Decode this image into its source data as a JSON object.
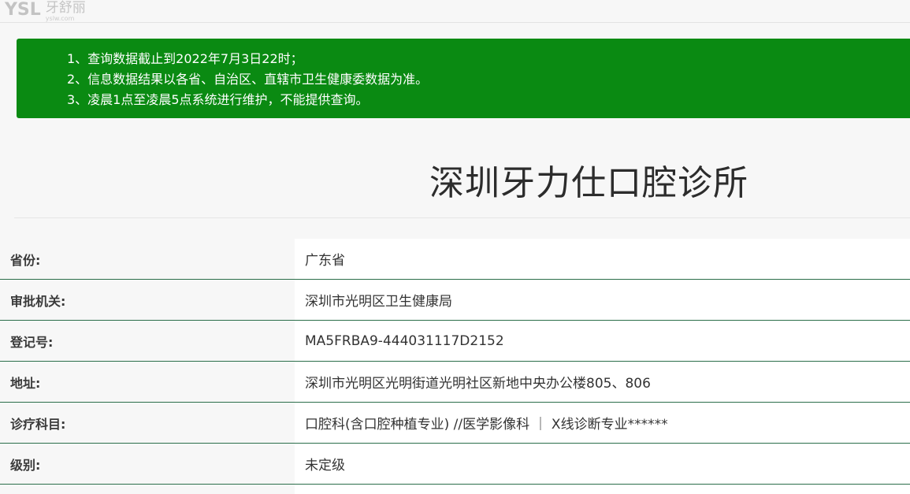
{
  "header": {
    "logo_mark": "YSL",
    "logo_cn": "牙舒丽",
    "logo_url": "yslw.com"
  },
  "notice": {
    "lines": [
      "1、查询数据截止到2022年7月3日22时；",
      "2、信息数据结果以各省、自治区、直辖市卫生健康委数据为准。",
      "3、凌晨1点至凌晨5点系统进行维护，不能提供查询。"
    ],
    "color": "#0a8a12"
  },
  "clinic": {
    "name": "深圳牙力仕口腔诊所"
  },
  "info": [
    {
      "label": "省份:",
      "value": "广东省"
    },
    {
      "label": "审批机关:",
      "value": "深圳市光明区卫生健康局"
    },
    {
      "label": "登记号:",
      "value": "MA5FRBA9-444031117D2152"
    },
    {
      "label": "地址:",
      "value": "深圳市光明区光明街道光明社区新地中央办公楼805、806"
    },
    {
      "label": "诊疗科目:",
      "value": "口腔科(含口腔种植专业) //医学影像科 ｜ X线诊断专业******"
    },
    {
      "label": "级别:",
      "value": "未定级"
    }
  ]
}
